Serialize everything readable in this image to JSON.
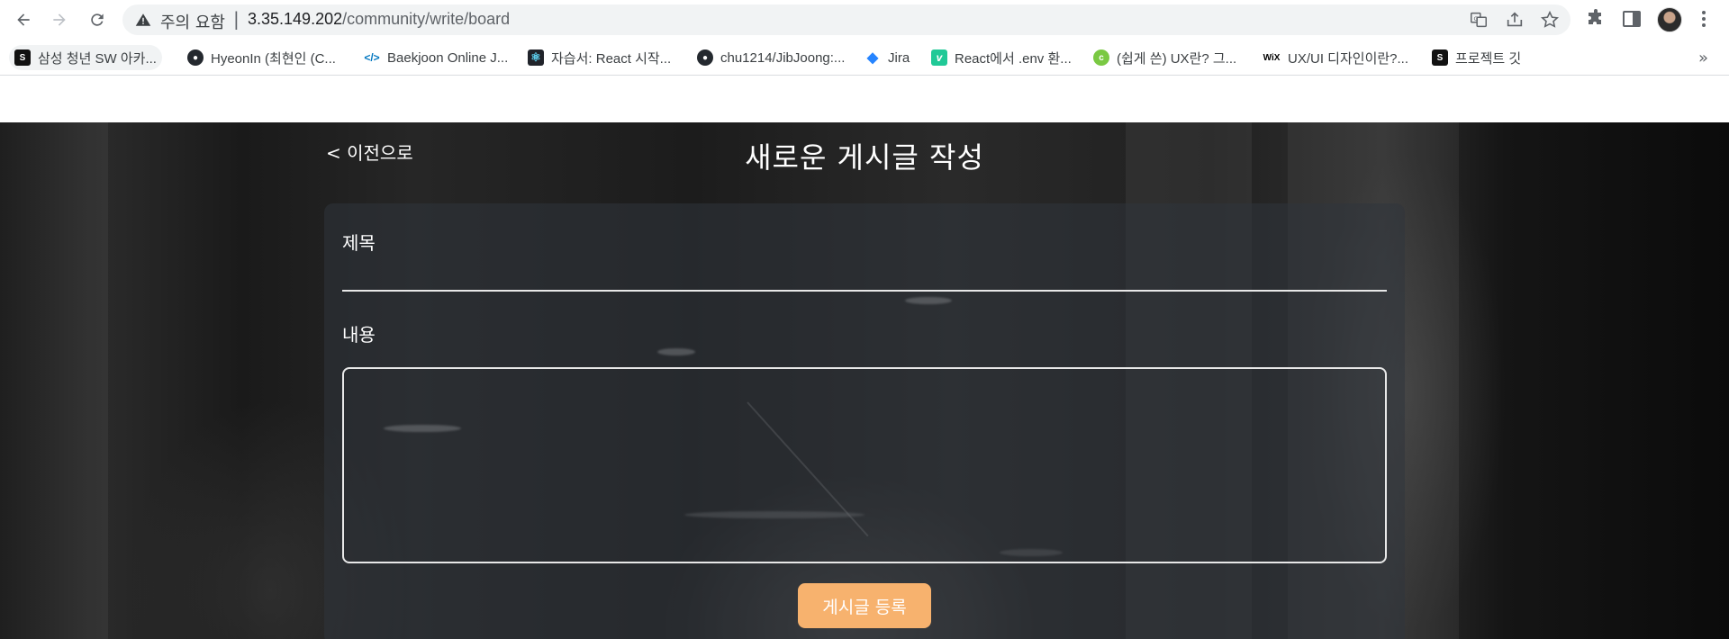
{
  "browser": {
    "security_label": "주의 요함",
    "url_host": "3.35.149.202",
    "url_path": "/community/write/board"
  },
  "bookmarks": [
    {
      "label": "삼성 청년 SW 아카...",
      "icon": "ssafy-favicon"
    },
    {
      "label": "HyeonIn (최현인 (C...",
      "icon": "github-icon"
    },
    {
      "label": "Baekjoon Online J...",
      "icon": "code-brackets-icon"
    },
    {
      "label": "자습서: React 시작...",
      "icon": "react-icon"
    },
    {
      "label": "chu1214/JibJoong:...",
      "icon": "github-icon"
    },
    {
      "label": "Jira",
      "icon": "jira-icon"
    },
    {
      "label": "React에서 .env 환...",
      "icon": "velog-icon"
    },
    {
      "label": "(쉽게 쓴) UX란? 그...",
      "icon": "green-circle-icon"
    },
    {
      "label": "UX/UI 디자인이란?...",
      "icon": "wix-icon"
    },
    {
      "label": "프로젝트 깃",
      "icon": "ssafy-favicon"
    }
  ],
  "page": {
    "back_label": "< 이전으로",
    "title": "새로운 게시글 작성",
    "form": {
      "title_label": "제목",
      "title_value": "",
      "content_label": "내용",
      "content_value": "",
      "submit_label": "게시글 등록"
    }
  },
  "colors": {
    "submit_button": "#f7b26e",
    "hero_background": "#1e1e1e"
  }
}
